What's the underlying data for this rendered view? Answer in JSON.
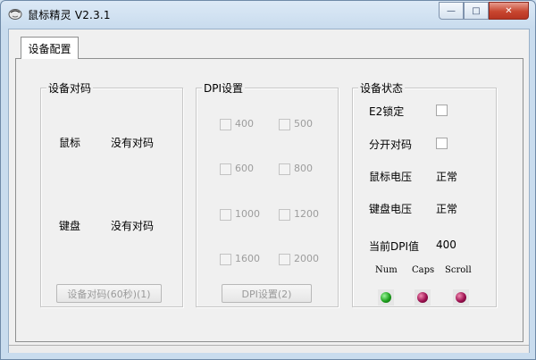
{
  "window": {
    "title": "鼠标精灵 V2.3.1",
    "minimize": "—",
    "maximize": "□",
    "close": "✕"
  },
  "tab": {
    "label": "设备配置"
  },
  "pairing": {
    "group_label": "设备对码",
    "mouse_label": "鼠标",
    "mouse_status": "没有对码",
    "keyboard_label": "键盘",
    "keyboard_status": "没有对码",
    "button_label": "设备对码(60秒)(1)"
  },
  "dpi": {
    "group_label": "DPI设置",
    "options": [
      "400",
      "500",
      "600",
      "800",
      "1000",
      "1200",
      "1600",
      "2000"
    ],
    "button_label": "DPI设置(2)"
  },
  "status": {
    "group_label": "设备状态",
    "e2_lock_label": "E2锁定",
    "split_pair_label": "分开对码",
    "mouse_voltage_label": "鼠标电压",
    "mouse_voltage_value": "正常",
    "keyboard_voltage_label": "键盘电压",
    "keyboard_voltage_value": "正常",
    "current_dpi_label": "当前DPI值",
    "current_dpi_value": "400",
    "indicators": [
      {
        "label": "Num",
        "color": "#1ea01e"
      },
      {
        "label": "Caps",
        "color": "#9d1050"
      },
      {
        "label": "Scroll",
        "color": "#9d1050"
      }
    ]
  }
}
